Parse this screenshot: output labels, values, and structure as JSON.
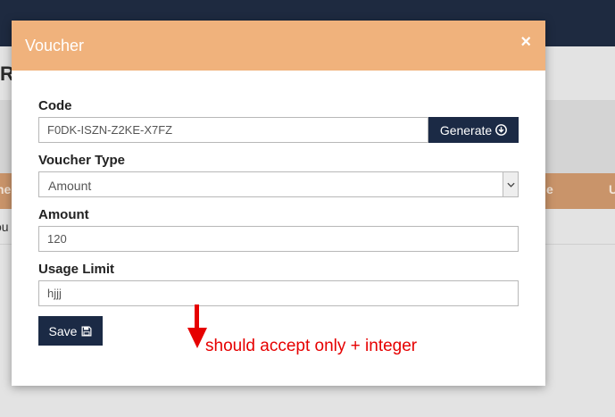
{
  "background": {
    "heading_partial": "R",
    "table_header_left_partial": "ne",
    "table_header_right_partial_1": "e",
    "table_header_right_partial_2": "U",
    "row_text_partial": "ou"
  },
  "modal": {
    "title": "Voucher",
    "close_symbol": "×",
    "code": {
      "label": "Code",
      "value": "F0DK-ISZN-Z2KE-X7FZ",
      "generate_label": "Generate"
    },
    "voucher_type": {
      "label": "Voucher Type",
      "selected": "Amount"
    },
    "amount": {
      "label": "Amount",
      "value": "120"
    },
    "usage_limit": {
      "label": "Usage Limit",
      "value": "hjjj"
    },
    "save_label": "Save"
  },
  "annotation": {
    "text": "should accept only + integer",
    "color": "#e60000"
  },
  "colors": {
    "header": "#f0b27c",
    "button": "#1b2a45",
    "topbar": "#1e2a40"
  }
}
